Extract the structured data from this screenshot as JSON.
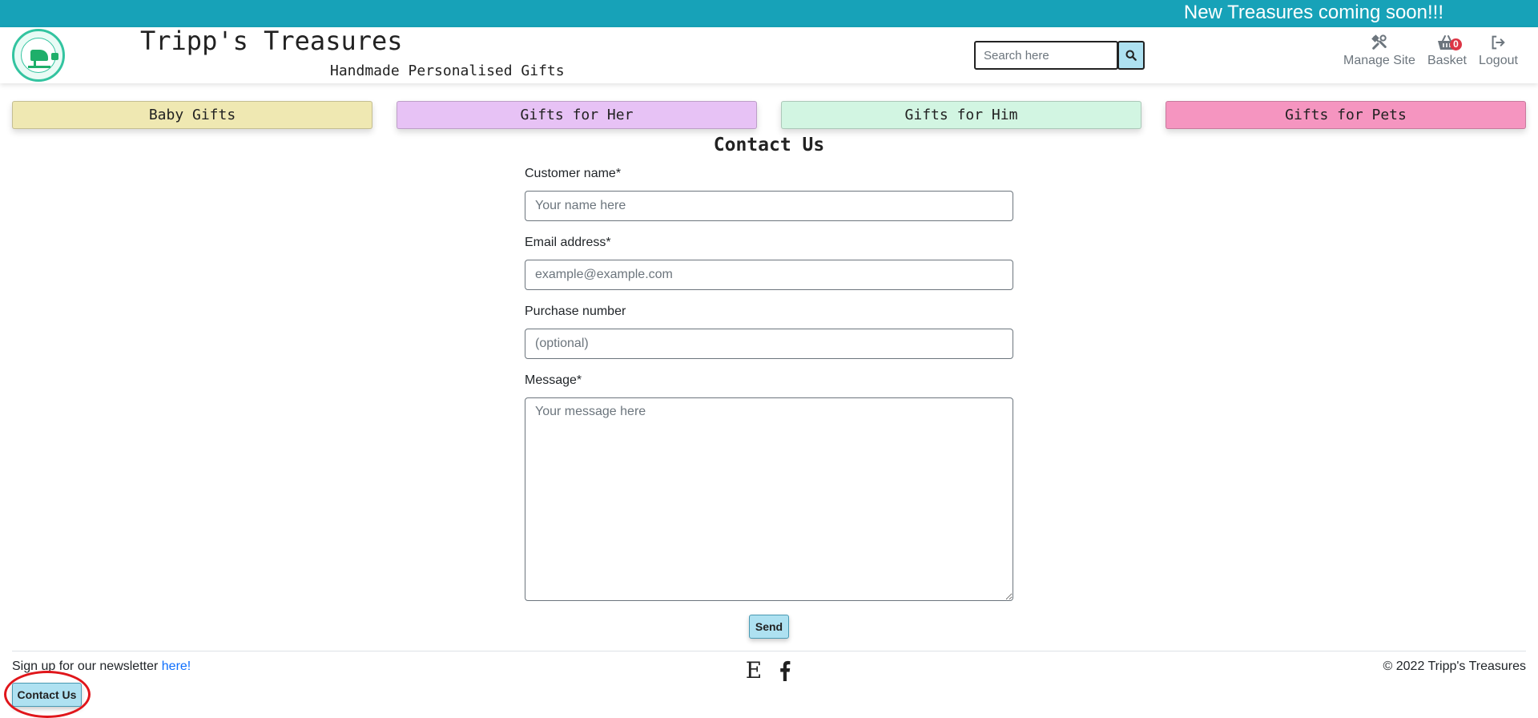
{
  "banner": {
    "text": "New Treasures coming soon!!!"
  },
  "header": {
    "title": "Tripp's Treasures",
    "subtitle": "Handmade Personalised Gifts",
    "search_placeholder": "Search here",
    "nav": {
      "manage_site": "Manage Site",
      "basket": "Basket",
      "basket_count": "0",
      "logout": "Logout"
    }
  },
  "categories": [
    {
      "label": "Baby Gifts",
      "color": "#efe8b2"
    },
    {
      "label": "Gifts for Her",
      "color": "#e7c2f5"
    },
    {
      "label": "Gifts for Him",
      "color": "#d2f5e2"
    },
    {
      "label": "Gifts for Pets",
      "color": "#f595c0"
    }
  ],
  "contact_form": {
    "title": "Contact Us",
    "customer_name_label": "Customer name*",
    "customer_name_placeholder": "Your name here",
    "email_label": "Email address*",
    "email_placeholder": "example@example.com",
    "purchase_label": "Purchase number",
    "purchase_placeholder": "(optional)",
    "message_label": "Message*",
    "message_placeholder": "Your message here",
    "send_label": "Send"
  },
  "footer": {
    "newsletter_text": "Sign up for our newsletter ",
    "newsletter_link": "here!",
    "etsy_glyph": "E",
    "copyright": "© 2022 Tripp's Treasures",
    "contact_button": "Contact Us"
  },
  "colors": {
    "banner": "#17a2b8",
    "button": "#aee1f1",
    "badge": "#dc3545",
    "highlight": "#e0161b"
  }
}
